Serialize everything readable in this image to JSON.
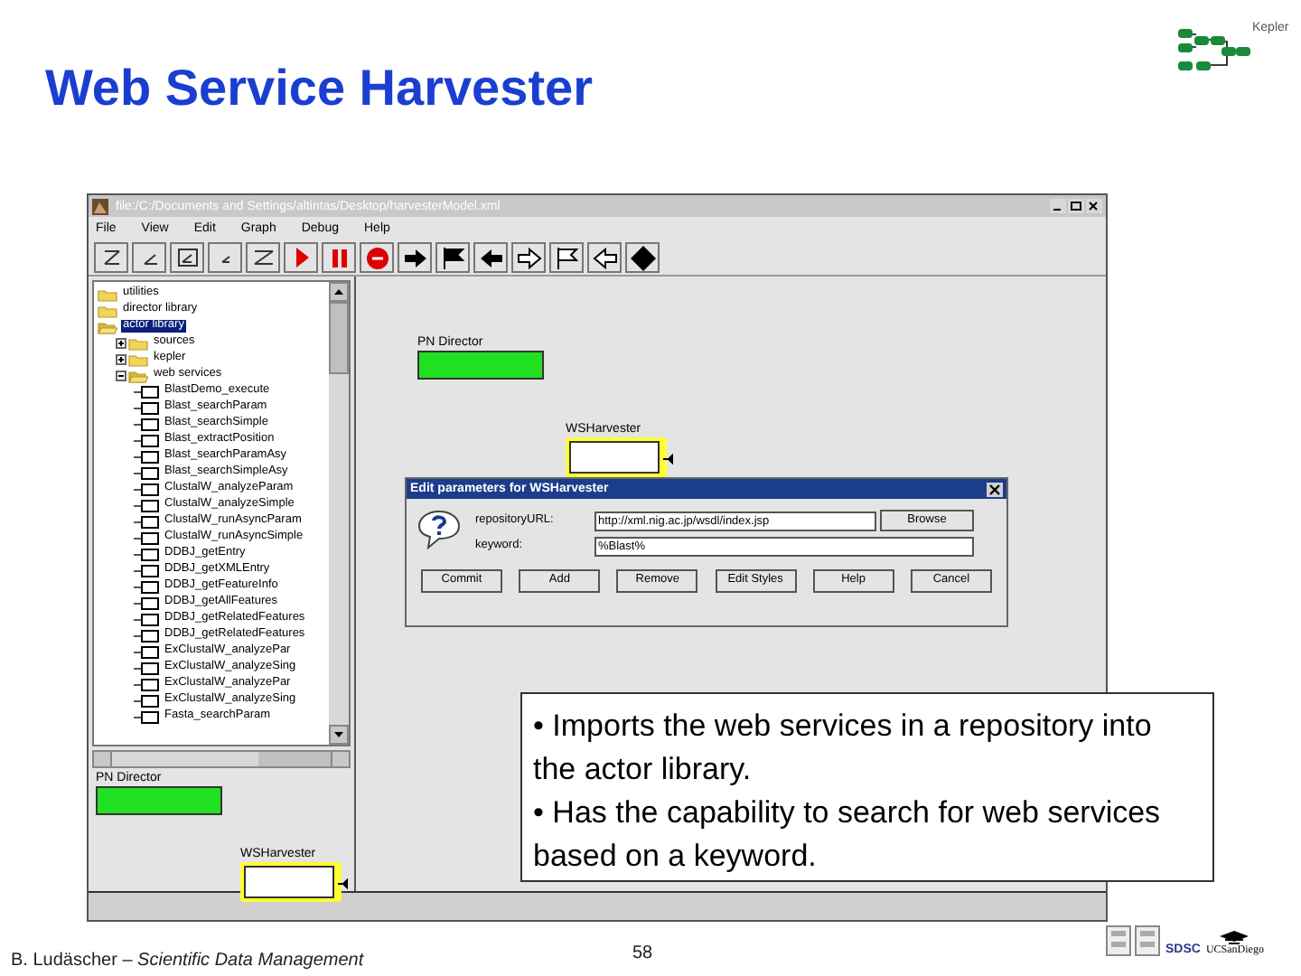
{
  "slide": {
    "title": "Web Service Harvester",
    "logo_label": "Kepler",
    "footer_author": "B. Ludäscher – ",
    "footer_topic": "Scientific Data Management",
    "page_number": "58",
    "footer_logo_labels": [
      "SDSC",
      "UCSanDiego"
    ]
  },
  "window": {
    "title": "file:/C:/Documents and Settings/altintas/Desktop/harvesterModel.xml",
    "menu": [
      "File",
      "View",
      "Edit",
      "Graph",
      "Debug",
      "Help"
    ],
    "tree": [
      {
        "label": "utilities",
        "selected": false,
        "expanded": false
      },
      {
        "label": "director library",
        "selected": false,
        "expanded": false
      },
      {
        "label": "actor library",
        "selected": true,
        "expanded": true,
        "children": [
          {
            "label": "sources",
            "selected": false,
            "expanded": false
          },
          {
            "label": "kepler",
            "selected": false,
            "expanded": false
          },
          {
            "label": "web services",
            "selected": false,
            "expanded": true,
            "children": [
              {
                "label": "BlastDemo_execute",
                "selected": false
              },
              {
                "label": "Blast_searchParam",
                "selected": false
              },
              {
                "label": "Blast_searchSimple",
                "selected": false
              },
              {
                "label": "Blast_extractPosition",
                "selected": false
              },
              {
                "label": "Blast_searchParamAsy",
                "selected": false
              },
              {
                "label": "Blast_searchSimpleAsy",
                "selected": false
              },
              {
                "label": "ClustalW_analyzeParam",
                "selected": false
              },
              {
                "label": "ClustalW_analyzeSimple",
                "selected": false
              },
              {
                "label": "ClustalW_runAsyncParam",
                "selected": false
              },
              {
                "label": "ClustalW_runAsyncSimple",
                "selected": false
              },
              {
                "label": "DDBJ_getEntry",
                "selected": false
              },
              {
                "label": "DDBJ_getXMLEntry",
                "selected": false
              },
              {
                "label": "DDBJ_getFeatureInfo",
                "selected": false
              },
              {
                "label": "DDBJ_getAllFeatures",
                "selected": false
              },
              {
                "label": "DDBJ_getRelatedFeatures",
                "selected": false
              },
              {
                "label": "DDBJ_getRelatedFeatures",
                "selected": false
              },
              {
                "label": "ExClustalW_analyzePar",
                "selected": false
              },
              {
                "label": "ExClustalW_analyzeSing",
                "selected": false
              },
              {
                "label": "ExClustalW_analyzePar",
                "selected": false
              },
              {
                "label": "ExClustalW_analyzeSing",
                "selected": false
              },
              {
                "label": "Fasta_searchParam",
                "selected": false
              }
            ]
          }
        ]
      }
    ],
    "canvas_actors": [
      {
        "kind": "director",
        "label": "PN Director"
      },
      {
        "kind": "actor",
        "label": "WSHarvester"
      }
    ],
    "preview_actors": [
      {
        "kind": "director",
        "label": "PN Director"
      },
      {
        "kind": "actor",
        "label": "WSHarvester"
      }
    ]
  },
  "dialog": {
    "title": "Edit parameters for WSHarvester",
    "fields": [
      {
        "label": "repositoryURL:",
        "value": "http://xml.nig.ac.jp/wsdl/index.jsp",
        "button": "Browse"
      },
      {
        "label": "keyword:",
        "value": "%Blast%"
      }
    ],
    "buttons": [
      "Commit",
      "Add",
      "Remove",
      "Edit Styles",
      "Help",
      "Cancel"
    ]
  },
  "callout": [
    "• Imports the web services in a repository into the actor library.",
    "• Has the capability to search for web services based on a keyword."
  ]
}
